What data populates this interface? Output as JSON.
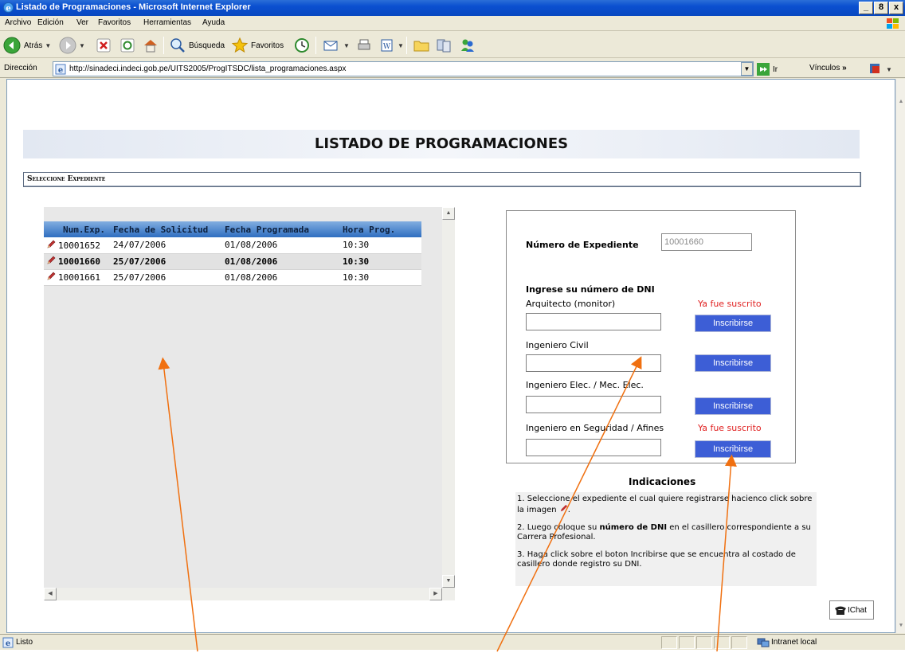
{
  "window": {
    "title": "Listado de Programaciones - Microsoft Internet Explorer",
    "minimize_label": "_",
    "maximize_label": "8",
    "close_label": "x"
  },
  "menubar": {
    "items": [
      "Archivo",
      "Edición",
      "Ver",
      "Favoritos",
      "Herramientas",
      "Ayuda"
    ]
  },
  "toolbar": {
    "back_label": "Atrás",
    "search_label": "Búsqueda",
    "favorites_label": "Favoritos"
  },
  "addressbar": {
    "label": "Dirección",
    "url": "http://sinadeci.indeci.gob.pe/UITS2005/ProgITSDC/lista_programaciones.aspx",
    "go_label": "Ir",
    "links_label": "Vínculos"
  },
  "page": {
    "title": "LISTADO DE PROGRAMACIONES",
    "section_title": "Seleccione Expediente"
  },
  "grid": {
    "columns": [
      "Num.Exp.",
      "Fecha de Solicitud",
      "Fecha Programada",
      "Hora Prog."
    ],
    "rows": [
      {
        "num": "10001652",
        "solicitud": "24/07/2006",
        "programada": "01/08/2006",
        "hora": "10:30"
      },
      {
        "num": "10001660",
        "solicitud": "25/07/2006",
        "programada": "01/08/2006",
        "hora": "10:30"
      },
      {
        "num": "10001661",
        "solicitud": "25/07/2006",
        "programada": "01/08/2006",
        "hora": "10:30"
      }
    ],
    "selected_index": 1
  },
  "form": {
    "expediente_label": "Número de Expediente",
    "expediente_value": "10001660",
    "dni_heading": "Ingrese su número de DNI",
    "fields": [
      {
        "label": "Arquitecto (monitor)",
        "status": "Ya fue suscrito",
        "button": "Inscribirse"
      },
      {
        "label": "Ingeniero Civil",
        "status": "",
        "button": "Inscribirse"
      },
      {
        "label": "Ingeniero Elec. / Mec. Elec.",
        "status": "",
        "button": "Inscribirse"
      },
      {
        "label": "Ingeniero en Seguridad / Afines",
        "status": "Ya fue suscrito",
        "button": "Inscribirse"
      }
    ]
  },
  "instructions": {
    "title": "Indicaciones",
    "step1": "1. Seleccione el expediente el cual quiere registrarse hacienco click sobre la imagen",
    "step2_pre": "2. Luego coloque su ",
    "step2_bold": "número de DNI",
    "step2_post": " en el casillero correspondiente a su Carrera Profesional.",
    "step3": "3. Haga click sobre el boton Incribirse que se encuentra al costado de casillero donde registro su DNI."
  },
  "chat": {
    "label": "IChat"
  },
  "statusbar": {
    "status": "Listo",
    "zone": "Intranet local"
  },
  "colors": {
    "title_bar": "#0a4fd0",
    "button_blue": "#3d5ed6",
    "status_red": "#e02020",
    "annotation_arrow": "#f07010"
  }
}
